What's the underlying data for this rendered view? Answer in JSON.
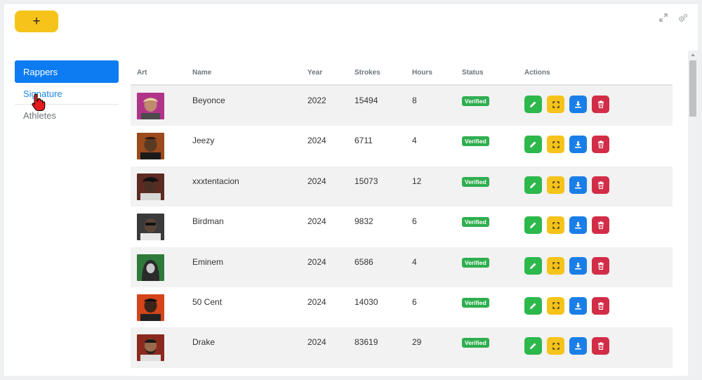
{
  "toolbar": {
    "add_label": "+"
  },
  "sidebar": {
    "items": [
      {
        "label": "Rappers"
      },
      {
        "label": "Signature"
      },
      {
        "label": "Athletes"
      }
    ]
  },
  "table": {
    "headers": [
      "Art",
      "Name",
      "Year",
      "Strokes",
      "Hours",
      "Status",
      "Actions"
    ],
    "rows": [
      {
        "name": "Beyonce",
        "year": "2022",
        "strokes": "15494",
        "hours": "8",
        "status": "Verified"
      },
      {
        "name": "Jeezy",
        "year": "2024",
        "strokes": "6711",
        "hours": "4",
        "status": "Verified"
      },
      {
        "name": "xxxtentacion",
        "year": "2024",
        "strokes": "15073",
        "hours": "12",
        "status": "Verified"
      },
      {
        "name": "Birdman",
        "year": "2024",
        "strokes": "9832",
        "hours": "6",
        "status": "Verified"
      },
      {
        "name": "Eminem",
        "year": "2024",
        "strokes": "6586",
        "hours": "4",
        "status": "Verified"
      },
      {
        "name": "50 Cent",
        "year": "2024",
        "strokes": "14030",
        "hours": "6",
        "status": "Verified"
      },
      {
        "name": "Drake",
        "year": "2024",
        "strokes": "83619",
        "hours": "29",
        "status": "Verified"
      }
    ]
  },
  "icons": {
    "expand": "expand-icon",
    "settings": "cogs-icon",
    "edit": "pencil-icon",
    "fullscreen": "fullscreen-icon",
    "download": "download-icon",
    "delete": "trash-icon"
  },
  "colors": {
    "accent": "#0d7cf2",
    "add_button": "#f6c31a",
    "verified": "#2fae4f",
    "edit": "#2db84c",
    "fullscreen": "#f6c31a",
    "download": "#1a7ee8",
    "delete": "#d22d48"
  }
}
